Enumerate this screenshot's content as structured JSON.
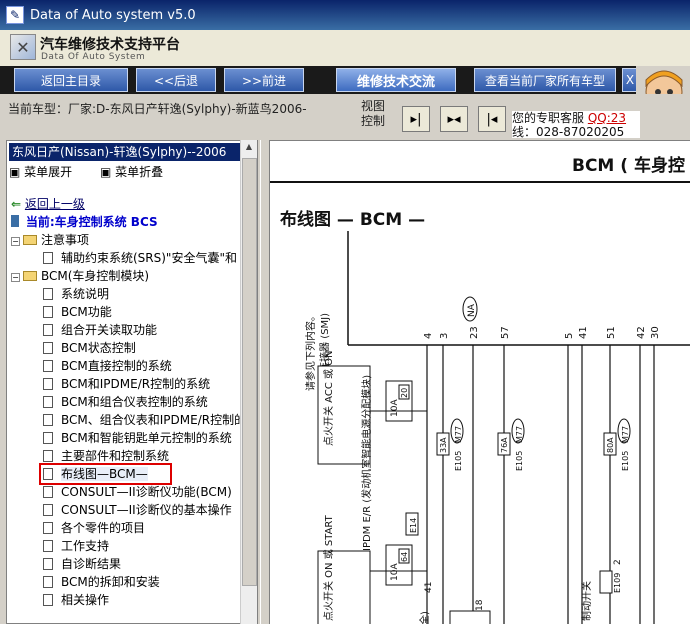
{
  "window": {
    "title": "Data of Auto system v5.0"
  },
  "brand": {
    "title_cn": "汽车维修技术支持平台",
    "title_en": "Data Of Auto System"
  },
  "toolbar": {
    "home": "返回主目录",
    "back": "<<后退",
    "forward": ">>前进",
    "feature": "维修技术交流",
    "brands": "查看当前厂家所有车型",
    "partial": "X"
  },
  "infobar": {
    "current_model": "当前车型：厂家:D-东风日产轩逸(Sylphy)-新蓝鸟2006-",
    "view_control": "视图控制",
    "service_line1": "您的专职客服",
    "service_qq": "QQ:23",
    "service_line2": "线：028-87020205"
  },
  "left": {
    "model_select": "东风日产(Nissan)-轩逸(Sylphy)--2006",
    "expand_all": "菜单展开",
    "collapse_all": "菜单折叠",
    "back_up": "返回上一级",
    "current_system": "当前:车身控制系统  BCS",
    "tree": [
      {
        "label": "注意事项",
        "type": "folder",
        "level": 0
      },
      {
        "label": "辅助约束系统(SRS)\"安全气囊\"和",
        "type": "page",
        "level": 1
      },
      {
        "label": "BCM(车身控制模块)",
        "type": "folder",
        "level": 0
      },
      {
        "label": "系统说明",
        "type": "page",
        "level": 1
      },
      {
        "label": "BCM功能",
        "type": "page",
        "level": 1
      },
      {
        "label": "组合开关读取功能",
        "type": "page",
        "level": 1
      },
      {
        "label": "BCM状态控制",
        "type": "page",
        "level": 1
      },
      {
        "label": "BCM直接控制的系统",
        "type": "page",
        "level": 1
      },
      {
        "label": "BCM和IPDME/R控制的系统",
        "type": "page",
        "level": 1
      },
      {
        "label": "BCM和组合仪表控制的系统",
        "type": "page",
        "level": 1
      },
      {
        "label": "BCM、组合仪表和IPDME/R控制的",
        "type": "page",
        "level": 1
      },
      {
        "label": "BCM和智能钥匙单元控制的系统",
        "type": "page",
        "level": 1
      },
      {
        "label": "主要部件和控制系统",
        "type": "page",
        "level": 1
      },
      {
        "label": "布线图—BCM—",
        "type": "page",
        "level": 1,
        "selected": true
      },
      {
        "label": "CONSULT—II诊断仪功能(BCM)",
        "type": "page",
        "level": 1
      },
      {
        "label": "CONSULT—II诊断仪的基本操作",
        "type": "page",
        "level": 1
      },
      {
        "label": "各个零件的项目",
        "type": "page",
        "level": 1
      },
      {
        "label": "工作支持",
        "type": "page",
        "level": 1
      },
      {
        "label": "自诊断结果",
        "type": "page",
        "level": 1
      },
      {
        "label": "BCM的拆卸和安装",
        "type": "page",
        "level": 1
      },
      {
        "label": "相关操作",
        "type": "page",
        "level": 1
      }
    ]
  },
  "doc": {
    "header": "BCM ( 车身控",
    "wiring_title": "布线图 — BCM —",
    "note": "请参见下列内容。",
    "note2": "(M77) - 超多路连接器 (SMJ)",
    "ign_acc": "点火开关 ACC 或 ON",
    "ign_start": "点火开关 ON 或 START",
    "ipdm": "IPDM E/R (发动机室智能电源分配模块)",
    "e14": "E14",
    "fuse1": "10A",
    "fuse1_no": "20",
    "fuse2": "10A",
    "fuse2_no": "64",
    "na": "NA",
    "wires": [
      "4",
      "3",
      "23",
      "57",
      "5",
      "41",
      "51",
      "42",
      "30"
    ],
    "conn_labels": [
      "33A",
      "76A",
      "80A"
    ],
    "conn_codes": [
      "E105",
      "M77"
    ],
    "wire_41": "41",
    "wire_18": "18",
    "wire_2": "2",
    "e109": "E109",
    "switch": "制动开关",
    "side": "全)"
  }
}
